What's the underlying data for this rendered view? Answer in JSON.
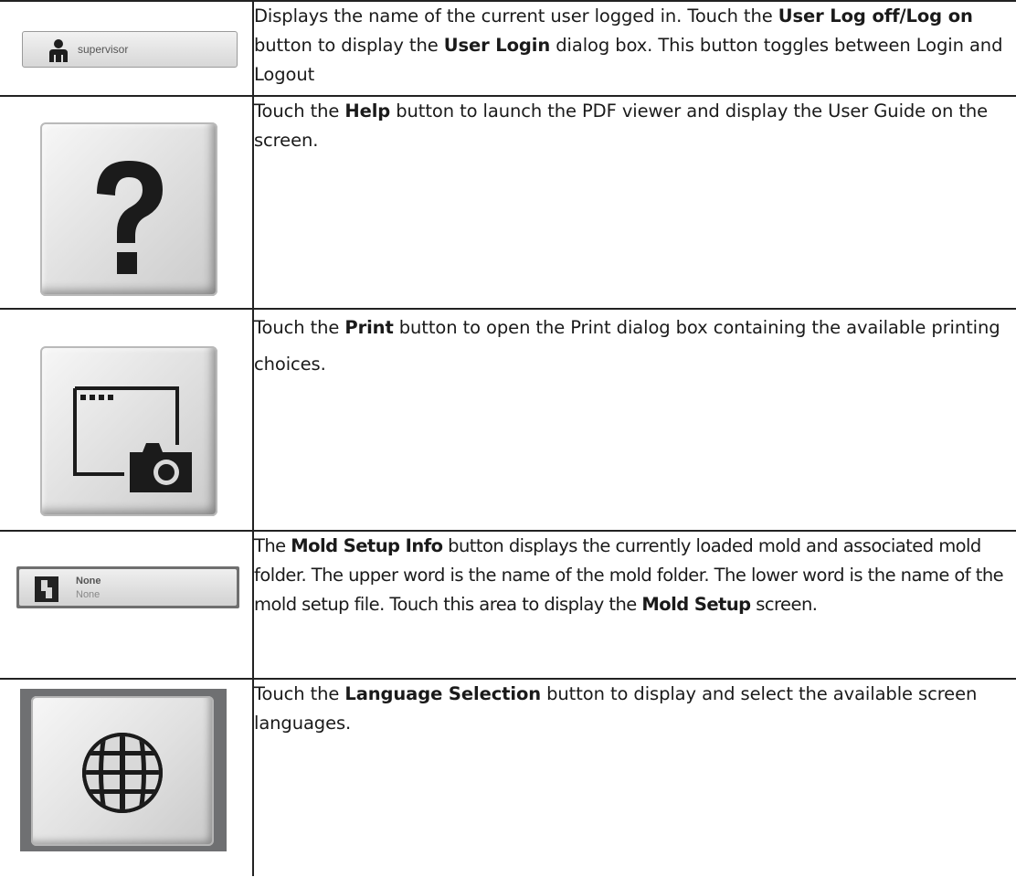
{
  "rows": [
    {
      "button_label": "supervisor",
      "icon": "user-icon",
      "text": {
        "p1": "Displays the name of the current user logged in. Touch the ",
        "b1": "User Log off/Log on",
        "p2": " button to display the ",
        "b2": "User Login",
        "p3": " dialog box. This button toggles between Login and Logout"
      }
    },
    {
      "icon": "help-question-icon",
      "text": {
        "p1": "Touch the ",
        "b1": "Help",
        "p2": " button to launch the PDF viewer and display the User Guide on the screen."
      }
    },
    {
      "icon": "print-screen-camera-icon",
      "text": {
        "p1": "Touch the ",
        "b1": "Print",
        "p2": " button to open the Print dialog box containing the available printing choices."
      }
    },
    {
      "icon": "mold-icon",
      "folder": "None",
      "file": "None",
      "text": {
        "p1": "The ",
        "b1": "Mold Setup Info",
        "p2": " button displays the currently loaded mold and associated mold folder. The upper word is the name of the mold folder. The lower word is the name of the mold setup file. Touch this area to display the ",
        "b2": "Mold Setup",
        "p3": " screen."
      }
    },
    {
      "icon": "globe-icon",
      "text": {
        "p1": "Touch the ",
        "b1": "Language Selection",
        "p2": " button to display and select the available screen languages."
      }
    }
  ]
}
